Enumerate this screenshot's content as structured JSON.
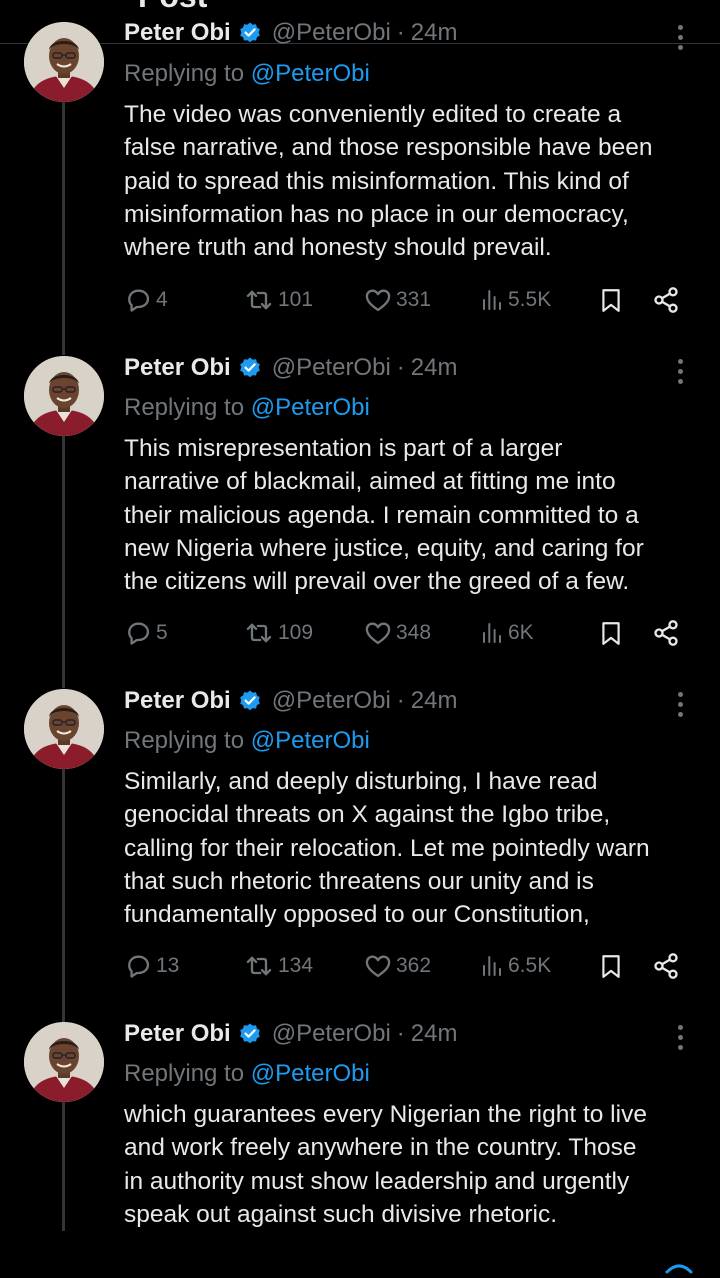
{
  "header": {
    "title": "Post"
  },
  "tweets": [
    {
      "author_name": "Peter Obi",
      "handle": "@PeterObi",
      "time": "24m",
      "replying_prefix": "Replying to",
      "replying_to": "@PeterObi",
      "text_lines": [
        "The video was conveniently edited to create a",
        "false narrative, and those responsible have been",
        "paid to spread this misinformation. This kind of",
        "misinformation has no place in our democracy,",
        "where truth and honesty should prevail."
      ],
      "replies": "4",
      "reposts": "101",
      "likes": "331",
      "views": "5.5K"
    },
    {
      "author_name": "Peter Obi",
      "handle": "@PeterObi",
      "time": "24m",
      "replying_prefix": "Replying to",
      "replying_to": "@PeterObi",
      "text_lines": [
        "This misrepresentation is part of a larger",
        "narrative of blackmail, aimed at fitting me into",
        "their malicious agenda. I remain committed to a",
        "new Nigeria where justice, equity, and caring for",
        "the citizens will prevail over the greed of a few."
      ],
      "replies": "5",
      "reposts": "109",
      "likes": "348",
      "views": "6K"
    },
    {
      "author_name": "Peter Obi",
      "handle": "@PeterObi",
      "time": "24m",
      "replying_prefix": "Replying to",
      "replying_to": "@PeterObi",
      "text_lines": [
        "Similarly, and deeply disturbing, I have read",
        "genocidal threats on X against the Igbo tribe,",
        "calling for their relocation. Let me pointedly warn",
        "that such rhetoric threatens our unity and is",
        "fundamentally opposed to our Constitution,"
      ],
      "replies": "13",
      "reposts": "134",
      "likes": "362",
      "views": "6.5K"
    },
    {
      "author_name": "Peter Obi",
      "handle": "@PeterObi",
      "time": "24m",
      "replying_prefix": "Replying to",
      "replying_to": "@PeterObi",
      "text_lines": [
        "which guarantees every Nigerian the right to live",
        "and work freely anywhere in the country. Those",
        "in authority must show leadership and urgently",
        "speak out against such divisive rhetoric."
      ]
    }
  ],
  "colors": {
    "background": "#000000",
    "text": "#e7e9ea",
    "muted": "#71767b",
    "accent": "#1d9bf0",
    "divider": "#2f3336"
  },
  "icons": [
    "back-arrow-icon",
    "verified-badge-icon",
    "more-icon",
    "reply-icon",
    "repost-icon",
    "like-icon",
    "views-icon",
    "bookmark-icon",
    "share-icon"
  ]
}
